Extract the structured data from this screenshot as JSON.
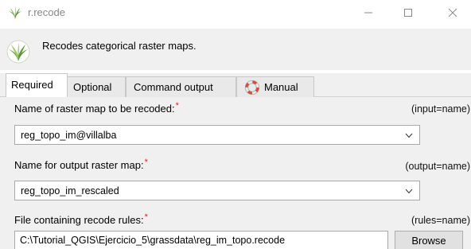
{
  "window": {
    "title": "r.recode"
  },
  "header": {
    "description": "Recodes categorical raster maps."
  },
  "tabs": [
    {
      "label": "Required",
      "active": true
    },
    {
      "label": "Optional",
      "active": false
    },
    {
      "label": "Command output",
      "active": false
    },
    {
      "label": "Manual",
      "active": false
    }
  ],
  "fields": {
    "input": {
      "label": "Name of raster map to be recoded:",
      "required_mark": "*",
      "key": "(input=name)",
      "value": "reg_topo_im@villalba"
    },
    "output": {
      "label": "Name for output raster map:",
      "required_mark": "*",
      "key": "(output=name)",
      "value": "reg_topo_im_rescaled"
    },
    "rules": {
      "label": "File containing recode rules:",
      "required_mark": "*",
      "key": "(rules=name)",
      "value": "C:\\Tutorial_QGIS\\Ejercicio_5\\grassdata\\reg_im_topo.recode",
      "browse_label": "Browse"
    }
  },
  "colors": {
    "panel_bg": "#f0f0f0",
    "required_star": "#e02020",
    "title_text": "#888888"
  },
  "icons": [
    "grass-logo-icon",
    "minimize-icon",
    "maximize-icon",
    "close-icon",
    "lifebuoy-icon",
    "chevron-down-icon"
  ]
}
